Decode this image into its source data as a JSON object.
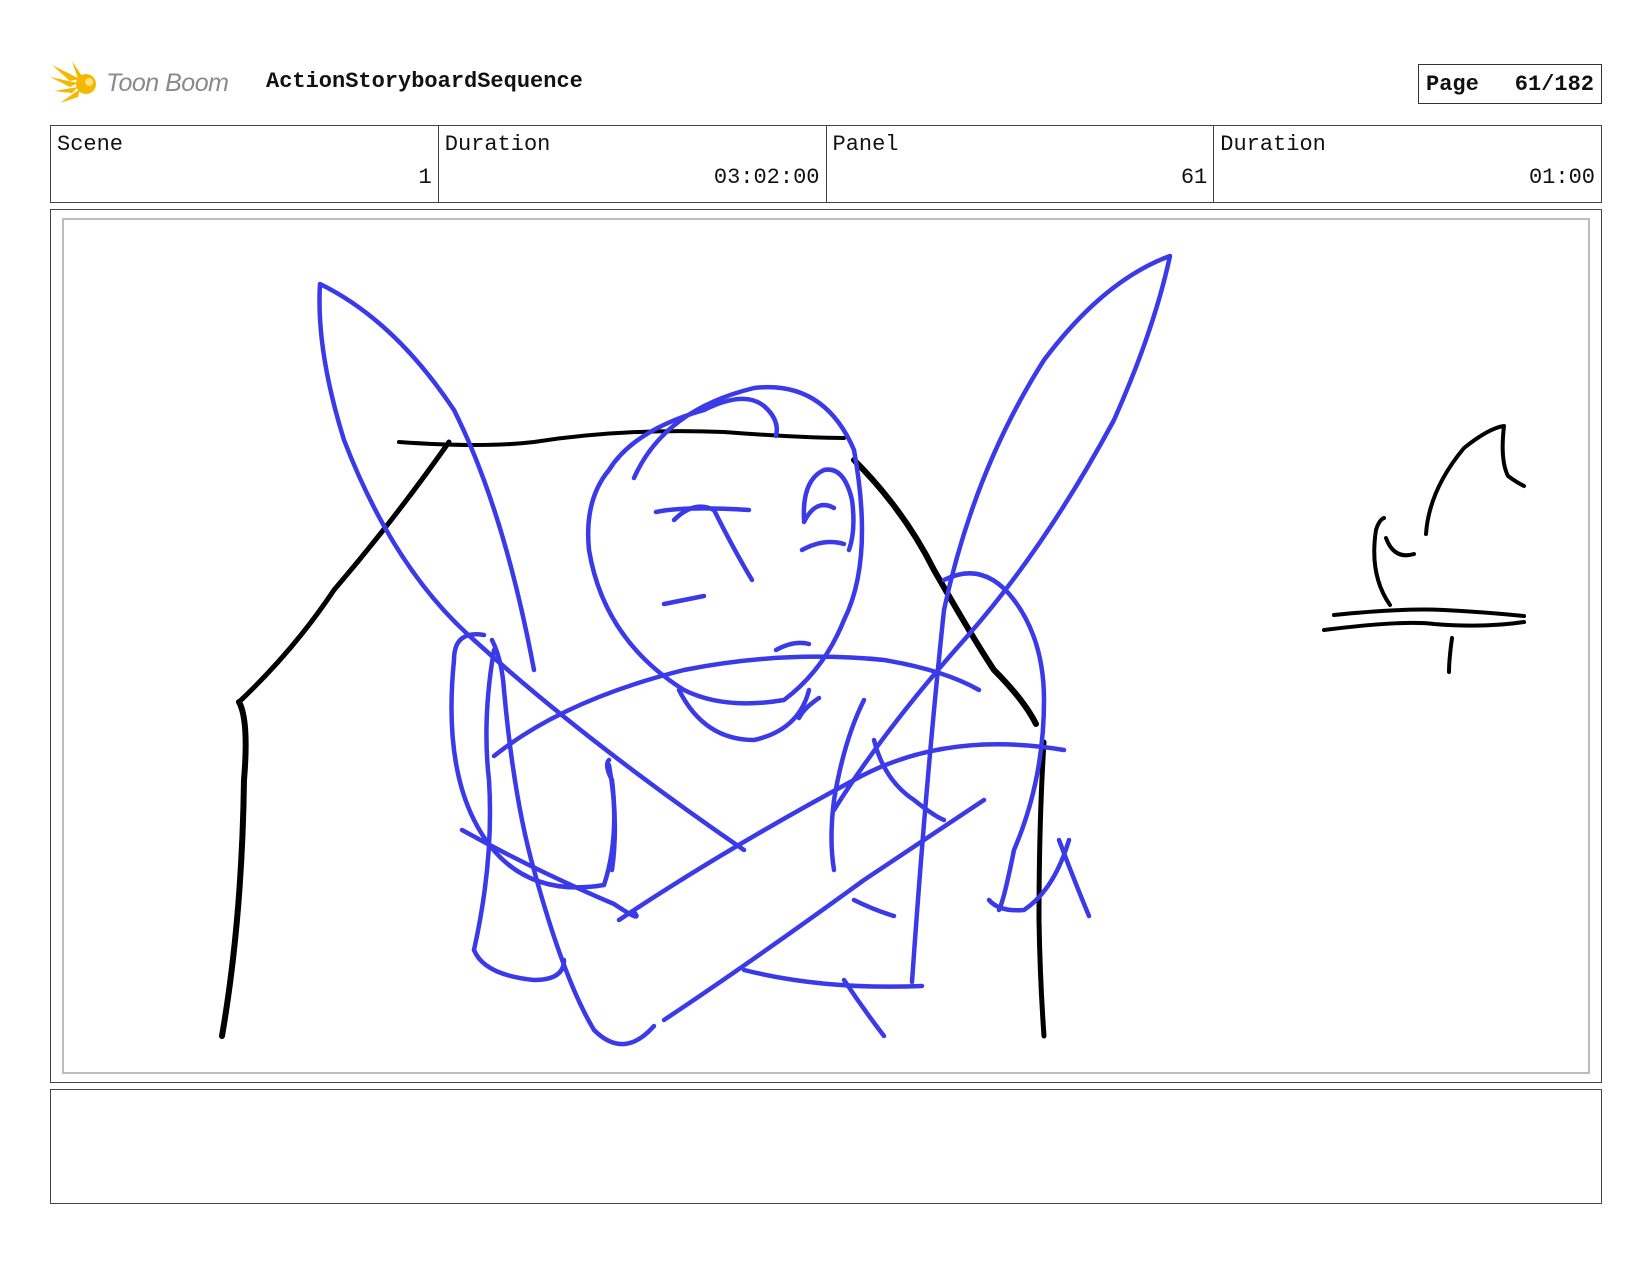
{
  "header": {
    "brand": "Toon Boom",
    "sequence_title": "ActionStoryboardSequence",
    "page_label": "Page",
    "page_value": "61/182"
  },
  "info": [
    {
      "label": "Scene",
      "value": "1"
    },
    {
      "label": "Duration",
      "value": "03:02:00"
    },
    {
      "label": "Panel",
      "value": "61"
    },
    {
      "label": "Duration",
      "value": "01:00"
    }
  ],
  "sketch": {
    "character_color": "#3a3ae8",
    "background_color": "#000000",
    "logo_color": "#f5b800"
  },
  "notes": ""
}
